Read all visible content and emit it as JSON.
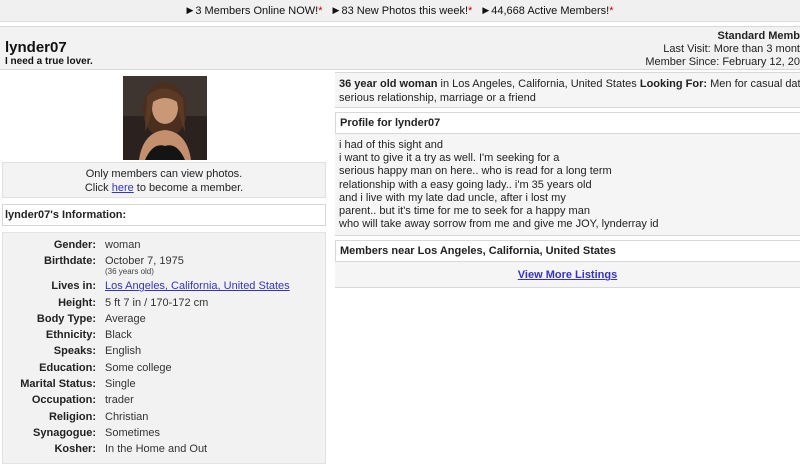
{
  "topbar": {
    "stats": [
      "3 Members Online NOW!",
      "83 New Photos this week!",
      "44,668 Active Members!"
    ]
  },
  "header": {
    "username": "lynder07",
    "tagline": "I need a true lover.",
    "membership": "Standard Memb",
    "last_visit": "Last Visit: More than 3 mont",
    "member_since": "Member Since: February 12, 20"
  },
  "photo": {
    "note_line1": "Only members can view photos.",
    "note_pre": "Click ",
    "note_link": "here",
    "note_post": " to become a member."
  },
  "info": {
    "heading": "lynder07's Information:",
    "gender_label": "Gender:",
    "gender": "woman",
    "birthdate_label": "Birthdate:",
    "birthdate": "October 7, 1975",
    "age_note": "(36 years old)",
    "lives_label": "Lives in:",
    "lives_in": "Los Angeles, California, United States",
    "height_label": "Height:",
    "height": "5 ft 7 in / 170-172 cm",
    "body_label": "Body Type:",
    "body_type": "Average",
    "ethnicity_label": "Ethnicity:",
    "ethnicity": "Black",
    "speaks_label": "Speaks:",
    "speaks": "English",
    "education_label": "Education:",
    "education": "Some college",
    "marital_label": "Marital Status:",
    "marital_status": "Single",
    "occupation_label": "Occupation:",
    "occupation": "trader",
    "religion_label": "Religion:",
    "religion": "Christian",
    "synagogue_label": "Synagogue:",
    "synagogue": "Sometimes",
    "kosher_label": "Kosher:",
    "kosher": "In the Home and Out"
  },
  "summary": {
    "bold1": "36 year old woman",
    "text1": " in Los Angeles, California, United States ",
    "bold2": "Looking For:",
    "text2": " Men for casual dating, a",
    "line2": "serious relationship, marriage or a friend"
  },
  "profile": {
    "heading": "Profile for lynder07",
    "lines": [
      "i had of this sight and",
      "i want to give it a try as well. I'm seeking for a",
      "serious happy man on here.. who is read for a long term",
      "relationship with a easy going lady.. i'm 35 years old",
      "and i live with my late dad uncle, after i lost my",
      "parent.. but it's time for me to seek for a happy man",
      "who will take away sorrow from me and give me JOY, lynderray id"
    ]
  },
  "nearby": {
    "heading": "Members near Los Angeles, California, United States",
    "view_more": "View More Listings"
  }
}
